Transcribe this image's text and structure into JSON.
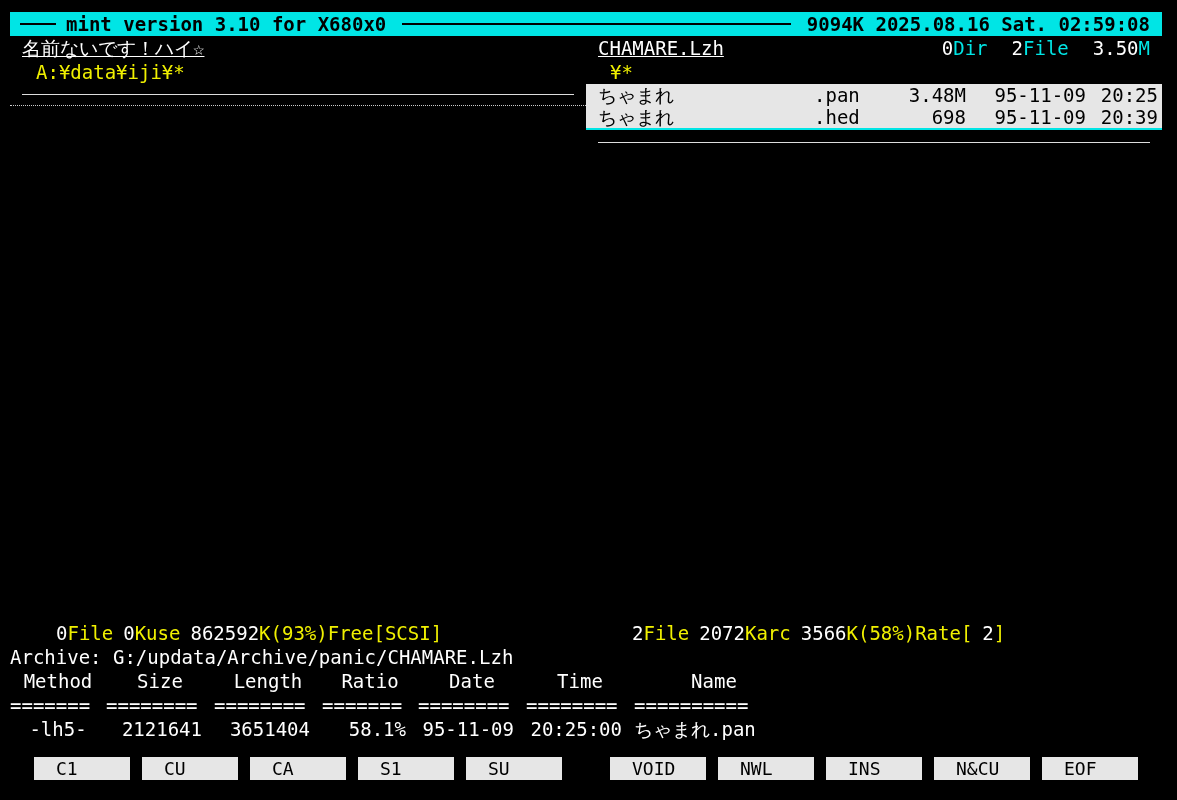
{
  "title_bar": {
    "title": "mint version 3.10  for X680x0",
    "status": "9094K 2025.08.16 Sat. 02:59:08"
  },
  "left_panel": {
    "volume_label": "名前ないです！ハイ☆",
    "path": "A:¥data¥iji¥*"
  },
  "right_panel": {
    "archive_name": "CHAMARE.Lzh",
    "path": "¥*",
    "counts": [
      {
        "value": "0",
        "unit": "Dir"
      },
      {
        "value": "2",
        "unit": "File"
      },
      {
        "value": "3.50",
        "unit": "M"
      }
    ],
    "files": [
      {
        "name": "ちゃまれ",
        "ext": ".pan",
        "size": "3.48M",
        "date": "95-11-09",
        "time": "20:25"
      },
      {
        "name": "ちゃまれ",
        "ext": ".hed",
        "size": "698",
        "date": "95-11-09",
        "time": "20:39"
      }
    ]
  },
  "stats_left": [
    {
      "kind": "number",
      "text": "0"
    },
    {
      "kind": "unit",
      "text": "File"
    },
    {
      "kind": "number",
      "text": "0"
    },
    {
      "kind": "unit",
      "text": "Kuse"
    },
    {
      "kind": "number",
      "text": "862592"
    },
    {
      "kind": "unit",
      "text": "K(93%)Free[SCSI]"
    }
  ],
  "stats_right": [
    {
      "kind": "number",
      "text": "2"
    },
    {
      "kind": "unit",
      "text": "File"
    },
    {
      "kind": "number",
      "text": "2072"
    },
    {
      "kind": "unit",
      "text": "Karc"
    },
    {
      "kind": "number",
      "text": "3566"
    },
    {
      "kind": "unit",
      "text": "K(58%)Rate["
    },
    {
      "kind": "number",
      "text": "2"
    },
    {
      "kind": "unit",
      "text": "]"
    }
  ],
  "archive_info": {
    "path_line": "Archive: G:/updata/Archive/panic/CHAMARE.Lzh",
    "columns": [
      "Method",
      "Size",
      "Length",
      "Ratio",
      "Date",
      "Time",
      "Name"
    ],
    "separators": [
      "=======",
      "========",
      "========",
      "=======",
      "========",
      "========",
      "=========="
    ],
    "rows": [
      [
        "-lh5-",
        "2121641",
        "3651404",
        "58.1%",
        "95-11-09",
        "20:25:00",
        "ちゃまれ.pan"
      ]
    ]
  },
  "function_keys": [
    [
      "C1",
      "CU",
      "CA",
      "S1",
      "SU"
    ],
    [
      "VOID",
      "NWL",
      "INS",
      "N&CU",
      "EOF"
    ]
  ]
}
